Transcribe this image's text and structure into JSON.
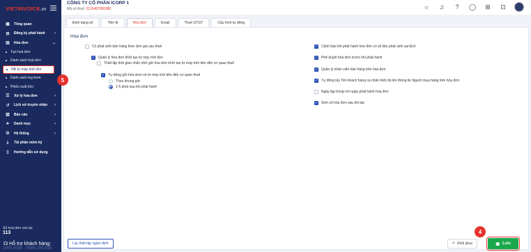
{
  "app": {
    "logo_text": "VIETINVOICE",
    "logo_sub": ".vn",
    "company_name": "CÔNG TY CỔ PHẦN ICORP 1",
    "tax_label": "Mã số thuế:",
    "tax_code": "0115487956980"
  },
  "sidebar": {
    "items": [
      {
        "label": "Tổng quan",
        "icon": "grid-icon"
      },
      {
        "label": "Đăng ký phát hành",
        "icon": "register-icon",
        "arrow": "›"
      },
      {
        "label": "Hóa đơn",
        "icon": "invoice-icon",
        "arrow": "⌄"
      },
      {
        "label": "Tạo hoá đơn"
      },
      {
        "label": "Danh sách hoá đơn"
      },
      {
        "label": "HĐ từ máy tính tiền"
      },
      {
        "label": "Danh sách log bơm"
      },
      {
        "label": "Phiếu xuất kho"
      },
      {
        "label": "Xử lý hóa đơn",
        "icon": "process-icon",
        "arrow": "›"
      },
      {
        "label": "Lịch sử truyền nhận",
        "icon": "history-icon",
        "arrow": "›"
      },
      {
        "label": "Báo cáo",
        "icon": "report-icon",
        "arrow": "›"
      },
      {
        "label": "Danh mục",
        "icon": "category-icon",
        "arrow": "›"
      },
      {
        "label": "Hệ thống",
        "icon": "system-icon",
        "arrow": "›"
      },
      {
        "label": "Tải phần mềm ký",
        "icon": "download-icon"
      },
      {
        "label": "Hướng dẫn sử dụng",
        "icon": "guide-icon"
      }
    ],
    "remain_label": "Số hoá đơn còn lại:",
    "remain_value": "113",
    "support_label": "Hỗ trợ khách hàng:",
    "support_phone": "1900.0098 - 0986.399.516"
  },
  "tabs": [
    "Định dạng số",
    "Tiền tệ",
    "Hóa đơn",
    "Email",
    "Thuế GTGT",
    "Cấu hình tự động"
  ],
  "active_tab": "Hóa đơn",
  "section_title": "Hóa đơn",
  "options_left": {
    "opt1": "Có phát sinh bán hàng theo đơn giá sau thuế",
    "opt2": "Quản lý hóa đơn khởi tạo từ máy tính tiền",
    "opt3": "Thiết lập thời gian nhắc nhở gửi hóa đơn khởi tạo từ máy tính tiền đến cơ quan thuế",
    "opt4": "Tự động gửi hóa đơn/ vé từ máy tính tiền đến cơ quan thuế",
    "radio1": "Theo khung giờ",
    "radio2": "1-5 phút sau khi phát hành"
  },
  "options_right": [
    "Cảnh báo khi phát hành hóa đơn có số liệu phát sinh sai lệch",
    "Phê duyệt hóa đơn trước khi phát hành",
    "Quản lý nhân viên bán hàng trên hóa đơn",
    "Tự động lấy Tên khách hàng cá nhân hiển thị lên thông tin Người mua hàng trên hóa đơn",
    "Ngày lập trùng với ngày phát hành hóa đơn",
    "Sinh số hóa đơn sau khi tạo"
  ],
  "footer": {
    "default_btn": "Lấy thiết lập ngầm định",
    "restore_btn": "Khôi phục",
    "save_btn": "Lưu"
  },
  "markers": {
    "step4": "4",
    "step5": "5"
  },
  "colors": {
    "sidebar": "#1a2a5e",
    "accent": "#e5322d",
    "checkbox": "#2a4fb5",
    "save": "#19a94b"
  }
}
